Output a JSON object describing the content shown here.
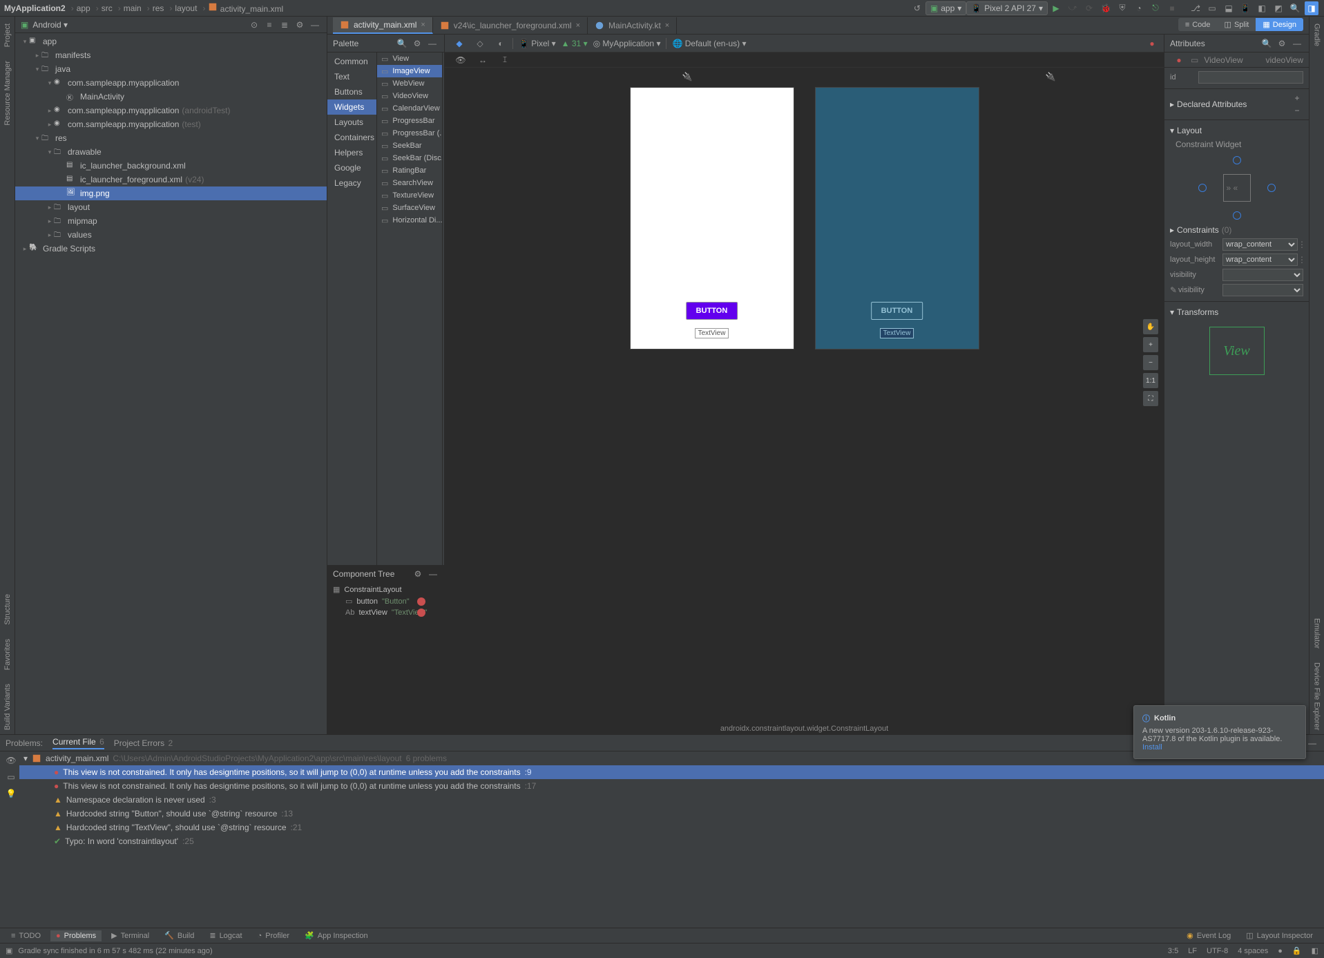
{
  "breadcrumbs": [
    "MyApplication2",
    "app",
    "src",
    "main",
    "res",
    "layout",
    "activity_main.xml"
  ],
  "topbar": {
    "run_config": "app",
    "device": "Pixel 2 API 27"
  },
  "left_stripe": [
    "Project",
    "Resource Manager"
  ],
  "right_stripe": [
    "Gradle",
    "Emulator",
    "Device File Explorer"
  ],
  "project_panel": {
    "title": "Android",
    "tree": [
      {
        "indent": 0,
        "arrow": "▾",
        "icon": "module",
        "label": "app"
      },
      {
        "indent": 1,
        "arrow": "▸",
        "icon": "folder",
        "label": "manifests"
      },
      {
        "indent": 1,
        "arrow": "▾",
        "icon": "folder",
        "label": "java"
      },
      {
        "indent": 2,
        "arrow": "▾",
        "icon": "pkg",
        "label": "com.sampleapp.myapplication"
      },
      {
        "indent": 3,
        "arrow": "",
        "icon": "kt",
        "label": "MainActivity"
      },
      {
        "indent": 2,
        "arrow": "▸",
        "icon": "pkg",
        "label": "com.sampleapp.myapplication",
        "note": "(androidTest)"
      },
      {
        "indent": 2,
        "arrow": "▸",
        "icon": "pkg",
        "label": "com.sampleapp.myapplication",
        "note": "(test)"
      },
      {
        "indent": 1,
        "arrow": "▾",
        "icon": "folder",
        "label": "res"
      },
      {
        "indent": 2,
        "arrow": "▾",
        "icon": "folder",
        "label": "drawable"
      },
      {
        "indent": 3,
        "arrow": "",
        "icon": "xml",
        "label": "ic_launcher_background.xml"
      },
      {
        "indent": 3,
        "arrow": "",
        "icon": "xml",
        "label": "ic_launcher_foreground.xml",
        "note": "(v24)"
      },
      {
        "indent": 3,
        "arrow": "",
        "icon": "img",
        "label": "img.png",
        "selected": true
      },
      {
        "indent": 2,
        "arrow": "▸",
        "icon": "folder",
        "label": "layout"
      },
      {
        "indent": 2,
        "arrow": "▸",
        "icon": "folder",
        "label": "mipmap"
      },
      {
        "indent": 2,
        "arrow": "▸",
        "icon": "folder",
        "label": "values"
      },
      {
        "indent": 0,
        "arrow": "▸",
        "icon": "gradle",
        "label": "Gradle Scripts"
      }
    ]
  },
  "editor_tabs": [
    {
      "label": "activity_main.xml",
      "active": true,
      "color": "#d77b40"
    },
    {
      "label": "v24\\ic_launcher_foreground.xml",
      "active": false,
      "color": "#d77b40"
    },
    {
      "label": "MainActivity.kt",
      "active": false,
      "color": "#6aa0d8"
    }
  ],
  "view_modes": {
    "code": "Code",
    "split": "Split",
    "design": "Design"
  },
  "palette": {
    "title": "Palette",
    "categories": [
      "Common",
      "Text",
      "Buttons",
      "Widgets",
      "Layouts",
      "Containers",
      "Helpers",
      "Google",
      "Legacy"
    ],
    "active_category": "Widgets",
    "widgets": [
      "View",
      "ImageView",
      "WebView",
      "VideoView",
      "CalendarView",
      "ProgressBar",
      "ProgressBar (...",
      "SeekBar",
      "SeekBar (Disc...",
      "RatingBar",
      "SearchView",
      "TextureView",
      "SurfaceView",
      "Horizontal Di..."
    ],
    "active_widget": "ImageView"
  },
  "canvas_toolbar": {
    "device": "Pixel",
    "api": "31",
    "app": "MyApplication",
    "locale": "Default (en-us)"
  },
  "design_surface": {
    "button_text": "BUTTON",
    "textview_text": "TextView",
    "footer_crumb": "androidx.constraintlayout.widget.ConstraintLayout"
  },
  "component_tree": {
    "title": "Component Tree",
    "items": [
      {
        "indent": 0,
        "icon": "layout",
        "label": "ConstraintLayout"
      },
      {
        "indent": 1,
        "icon": "btn",
        "label": "button",
        "hint": "\"Button\"",
        "err": true
      },
      {
        "indent": 1,
        "icon": "txt",
        "label": "textView",
        "hint": "\"TextView\"",
        "err": true
      }
    ]
  },
  "attributes": {
    "title": "Attributes",
    "component": "VideoView",
    "instance": "videoView",
    "id_label": "id",
    "sections": {
      "declared": "Declared Attributes",
      "layout": "Layout",
      "constraint_widget": "Constraint Widget",
      "constraints": "Constraints",
      "constraints_count": "(0)",
      "transforms": "Transforms"
    },
    "fields": {
      "layout_width": {
        "label": "layout_width",
        "value": "wrap_content"
      },
      "layout_height": {
        "label": "layout_height",
        "value": "wrap_content"
      },
      "visibility": {
        "label": "visibility",
        "value": ""
      },
      "visibility2": {
        "label": "visibility",
        "value": ""
      }
    },
    "view_preview": "View"
  },
  "problems": {
    "tabs": {
      "problems": "Problems:",
      "current_file": "Current File",
      "current_badge": "6",
      "project_errors": "Project Errors",
      "project_badge": "2"
    },
    "file": {
      "name": "activity_main.xml",
      "path": "C:\\Users\\Admin\\AndroidStudioProjects\\MyApplication2\\app\\src\\main\\res\\layout",
      "count": "6 problems"
    },
    "items": [
      {
        "sev": "err",
        "text": "This view is not constrained. It only has designtime positions, so it will jump to (0,0) at runtime unless you add the constraints",
        "line": ":9",
        "selected": true
      },
      {
        "sev": "err",
        "text": "This view is not constrained. It only has designtime positions, so it will jump to (0,0) at runtime unless you add the constraints",
        "line": ":17"
      },
      {
        "sev": "warn",
        "text": "Namespace declaration is never used",
        "line": ":3"
      },
      {
        "sev": "warn",
        "text": "Hardcoded string \"Button\", should use `@string` resource",
        "line": ":13"
      },
      {
        "sev": "warn",
        "text": "Hardcoded string \"TextView\", should use `@string` resource",
        "line": ":21"
      },
      {
        "sev": "typo",
        "text": "Typo: In word 'constraintlayout'",
        "line": ":25"
      }
    ]
  },
  "bottom_tabs": [
    "TODO",
    "Problems",
    "Terminal",
    "Build",
    "Logcat",
    "Profiler",
    "App Inspection"
  ],
  "bottom_right": {
    "event_log": "Event Log",
    "layout_inspector": "Layout Inspector"
  },
  "status": {
    "msg": "Gradle sync finished in 6 m 57 s 482 ms (22 minutes ago)",
    "pos": "3:5",
    "le": "LF",
    "enc": "UTF-8",
    "spaces": "4 spaces"
  },
  "notification": {
    "title": "Kotlin",
    "body": "A new version 203-1.6.10-release-923-AS7717.8 of the Kotlin plugin is available.",
    "link": "Install"
  }
}
